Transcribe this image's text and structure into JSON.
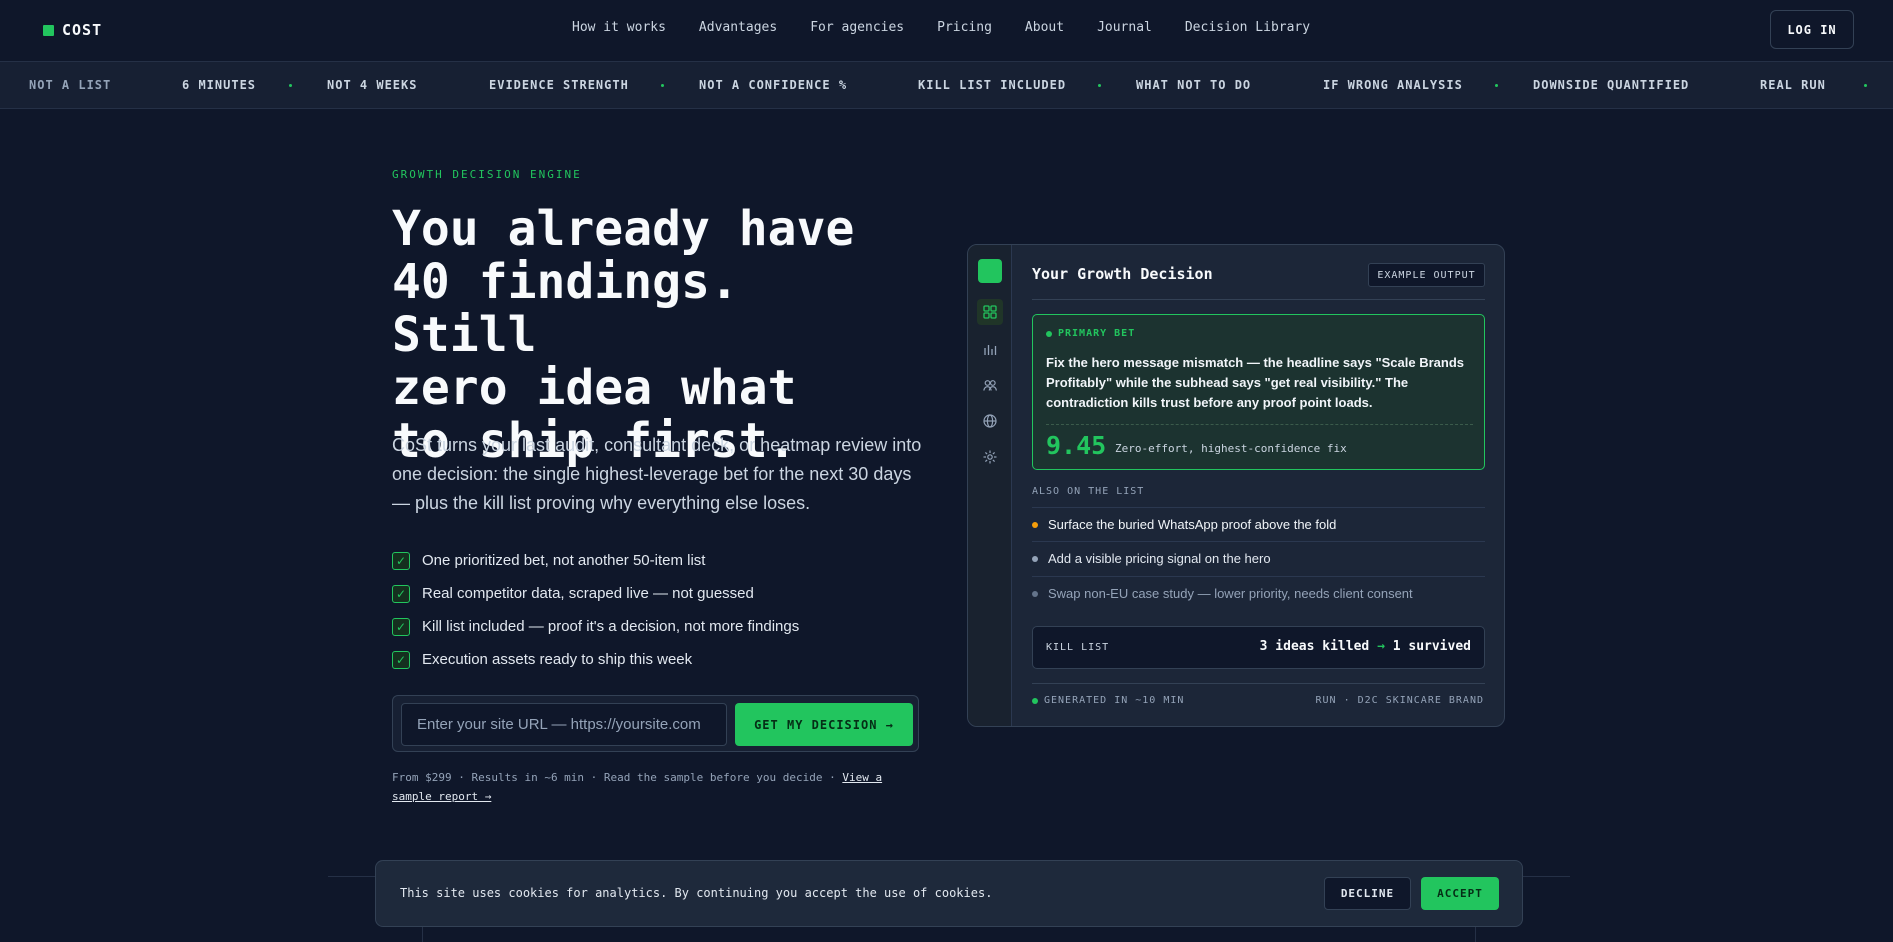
{
  "nav": {
    "logo_text": "COST",
    "links": [
      "How it works",
      "Advantages",
      "For agencies",
      "Pricing",
      "About",
      "Journal",
      "Decision Library"
    ],
    "login_label": "LOG IN"
  },
  "ticker": {
    "items": [
      "NOT A LIST",
      "6 MINUTES",
      "NOT 4 WEEKS",
      "EVIDENCE STRENGTH",
      "NOT A CONFIDENCE %",
      "KILL LIST INCLUDED",
      "WHAT NOT TO DO",
      "IF WRONG ANALYSIS",
      "DOWNSIDE QUANTIFIED",
      "REAL RUN"
    ]
  },
  "hero": {
    "eyebrow": "GROWTH DECISION ENGINE",
    "headline_lines": [
      "You already have",
      "40 findings. Still",
      "zero idea what",
      "to ship first."
    ],
    "subhead": "CoSt turns your last audit, consultant deck, or heatmap review into one decision: the single highest-leverage bet for the next 30 days — plus the kill list proving why everything else loses.",
    "checks": [
      "One prioritized bet, not another 50-item list",
      "Real competitor data, scraped live — not guessed",
      "Kill list included — proof it's a decision, not more findings",
      "Execution assets ready to ship this week"
    ],
    "url_placeholder": "Enter your site URL — https://yoursite.com",
    "cta_label": "GET MY DECISION →",
    "fineprint": "From $299 · Results in ~6 min · Read the sample before you decide · ",
    "fineprint_link": "View a sample report →"
  },
  "card": {
    "title": "Your Growth Decision",
    "tag": "EXAMPLE OUTPUT",
    "primary_label": "PRIMARY BET",
    "primary_text": "Fix the hero message mismatch — the headline says \"Scale Brands Profitably\" while the subhead says \"get real visibility.\" The contradiction kills trust before any proof point loads.",
    "score": "9.45",
    "score_note": "Zero-effort, highest-confidence fix",
    "also_label": "ALSO ON THE LIST",
    "also_items": [
      {
        "text": "Surface the buried WhatsApp proof above the fold",
        "color": "#f59e0b"
      },
      {
        "text": "Add a visible pricing signal on the hero",
        "color": "#94a3b8"
      },
      {
        "text": "Swap non-EU case study — lower priority, needs client consent",
        "color": "#64748b"
      }
    ],
    "kill_label": "KILL LIST",
    "kill_killed": "3 ideas killed",
    "kill_arrow": "→",
    "kill_survived": "1 survived",
    "footer_left": "GENERATED IN ~10 MIN",
    "footer_right": "RUN · D2C SKINCARE BRAND"
  },
  "cookie": {
    "text": "This site uses cookies for analytics. By continuing you accept the use of cookies.",
    "decline_label": "DECLINE",
    "accept_label": "ACCEPT"
  },
  "colors": {
    "accent": "#22c55e",
    "background": "#0f172a",
    "panel": "#1c2638"
  }
}
